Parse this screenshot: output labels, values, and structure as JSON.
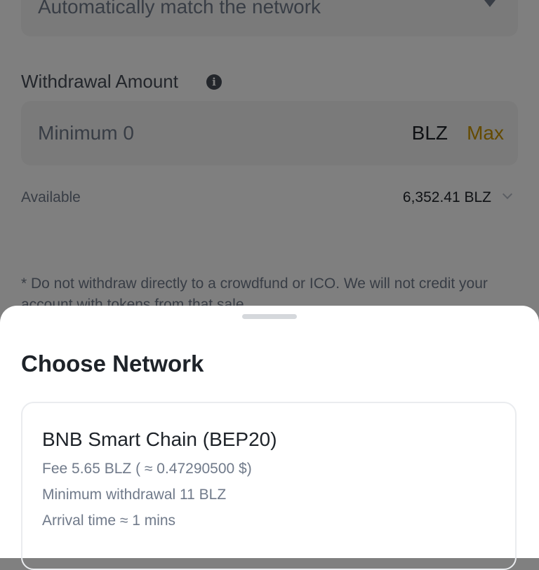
{
  "network_field": {
    "text": "Automatically match the network"
  },
  "amount": {
    "label": "Withdrawal Amount",
    "info_icon": "i",
    "placeholder": "Minimum 0",
    "currency": "BLZ",
    "max_label": "Max"
  },
  "available": {
    "label": "Available",
    "value": "6,352.41 BLZ"
  },
  "warning": "* Do not withdraw directly to a crowdfund or ICO. We will not credit your account with tokens from that sale.",
  "sheet": {
    "title": "Choose Network",
    "networks": [
      {
        "name": "BNB Smart Chain (BEP20)",
        "fee": "Fee 5.65 BLZ ( ≈ 0.47290500 $)",
        "min_withdrawal": "Minimum withdrawal 11 BLZ",
        "arrival": "Arrival time ≈ 1 mins"
      }
    ]
  },
  "colors": {
    "accent": "#c99400",
    "text_primary": "#1e2329",
    "text_secondary": "#707a8a",
    "overlay": "rgba(0,0,0,0.5)"
  }
}
